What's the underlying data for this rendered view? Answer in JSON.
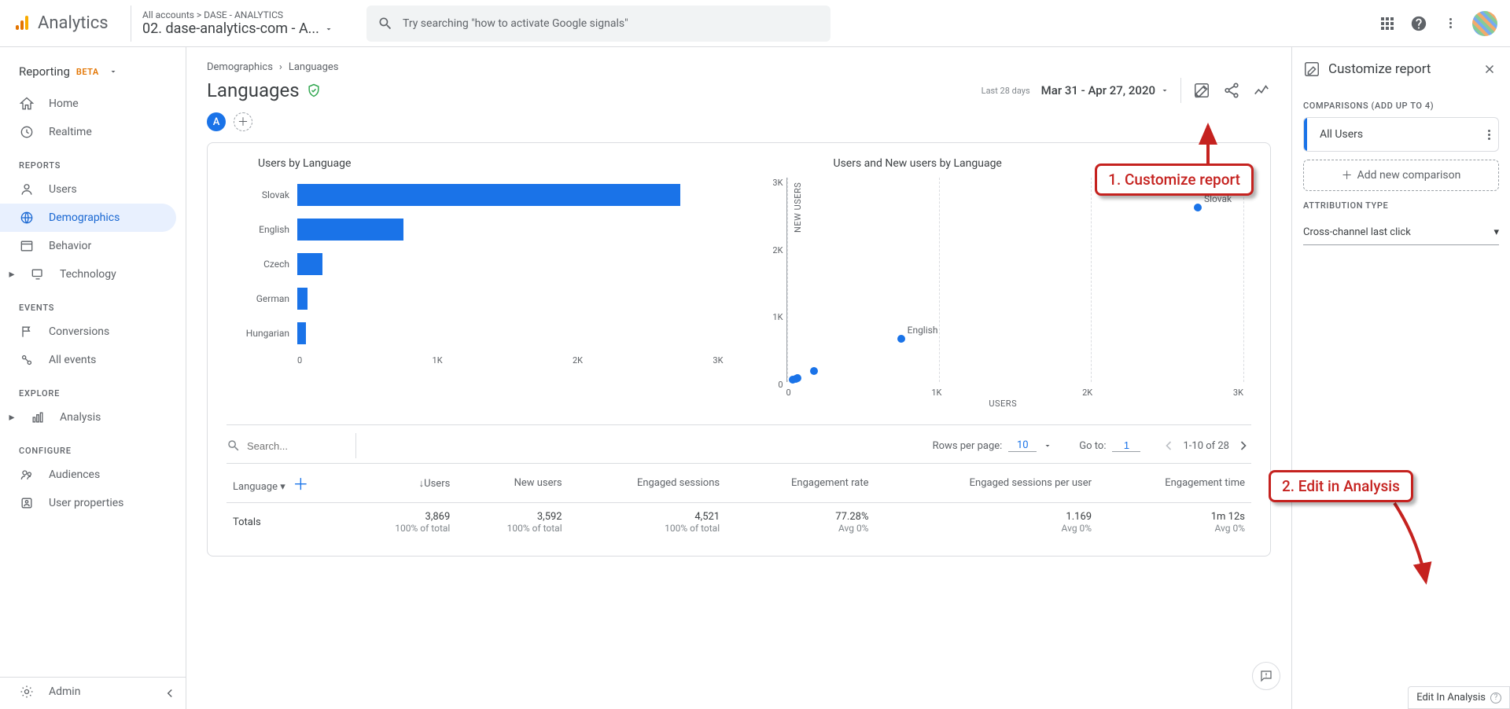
{
  "topbar": {
    "product": "Analytics",
    "account_crumb": "All accounts > DASE - ANALYTICS",
    "property": "02. dase-analytics-com - A...",
    "search_placeholder": "Try searching \"how to activate Google signals\""
  },
  "sidebar": {
    "reporting": "Reporting",
    "beta": "BETA",
    "items_top": [
      {
        "label": "Home"
      },
      {
        "label": "Realtime"
      }
    ],
    "sections": [
      {
        "title": "REPORTS",
        "items": [
          {
            "label": "Users"
          },
          {
            "label": "Demographics",
            "active": true
          },
          {
            "label": "Behavior"
          },
          {
            "label": "Technology",
            "caret": true
          }
        ]
      },
      {
        "title": "EVENTS",
        "items": [
          {
            "label": "Conversions"
          },
          {
            "label": "All events"
          }
        ]
      },
      {
        "title": "EXPLORE",
        "items": [
          {
            "label": "Analysis",
            "caret": true
          }
        ]
      },
      {
        "title": "CONFIGURE",
        "items": [
          {
            "label": "Audiences"
          },
          {
            "label": "User properties"
          }
        ]
      }
    ],
    "admin": "Admin"
  },
  "breadcrumbs": [
    "Demographics",
    "Languages"
  ],
  "page_title": "Languages",
  "date": {
    "label": "Last 28 days",
    "range": "Mar 31 - Apr 27, 2020"
  },
  "chip": "A",
  "chart_data": [
    {
      "type": "bar",
      "title": "Users by Language",
      "categories": [
        "Slovak",
        "English",
        "Czech",
        "German",
        "Hungarian"
      ],
      "values": [
        2700,
        750,
        180,
        70,
        60
      ],
      "xlabel": "",
      "ylabel": "",
      "xlim": [
        0,
        3000
      ],
      "xticks": [
        "0",
        "1K",
        "2K",
        "3K"
      ]
    },
    {
      "type": "scatter",
      "title": "Users and New users by Language",
      "xlabel": "USERS",
      "ylabel": "NEW USERS",
      "xlim": [
        0,
        3000
      ],
      "ylim": [
        0,
        3000
      ],
      "xticks": [
        "0",
        "1K",
        "2K",
        "3K"
      ],
      "yticks": [
        "3K",
        "2K",
        "1K",
        "0"
      ],
      "points": [
        {
          "label": "Slovak",
          "x": 2700,
          "y": 2560
        },
        {
          "label": "English",
          "x": 750,
          "y": 640
        },
        {
          "label": "",
          "x": 180,
          "y": 160
        },
        {
          "label": "",
          "x": 70,
          "y": 55
        },
        {
          "label": "",
          "x": 60,
          "y": 48
        },
        {
          "label": "",
          "x": 40,
          "y": 35
        }
      ]
    }
  ],
  "table_controls": {
    "search_placeholder": "Search...",
    "rows_label": "Rows per page:",
    "rows_value": "10",
    "goto_label": "Go to:",
    "goto_value": "1",
    "range": "1-10 of 28"
  },
  "table": {
    "dim_header": "Language",
    "columns": [
      "Users",
      "New users",
      "Engaged sessions",
      "Engagement rate",
      "Engaged sessions per user",
      "Engagement time"
    ],
    "totals_label": "Totals",
    "totals": [
      {
        "v": "3,869",
        "s": "100% of total"
      },
      {
        "v": "3,592",
        "s": "100% of total"
      },
      {
        "v": "4,521",
        "s": "100% of total"
      },
      {
        "v": "77.28%",
        "s": "Avg 0%"
      },
      {
        "v": "1.169",
        "s": "Avg 0%"
      },
      {
        "v": "1m 12s",
        "s": "Avg 0%"
      }
    ]
  },
  "rpanel": {
    "title": "Customize report",
    "comparisons_label": "COMPARISONS (ADD UP TO 4)",
    "comparison_item": "All Users",
    "add_comparison": "Add new comparison",
    "attr_label": "ATTRIBUTION TYPE",
    "attr_value": "Cross-channel last click",
    "edit_btn": "Edit In Analysis"
  },
  "callouts": {
    "c1": "1. Customize report",
    "c2": "2. Edit in Analysis"
  }
}
